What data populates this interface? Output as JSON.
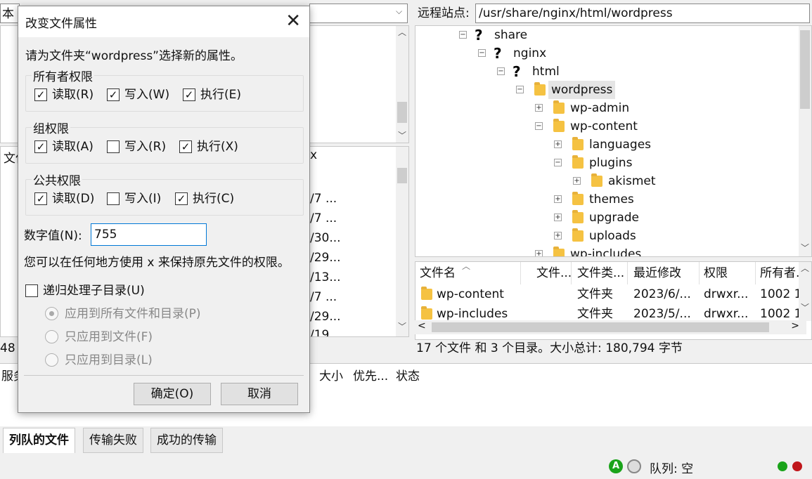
{
  "local": {
    "tab_label_partial": "本地",
    "col_name_partial": "文件",
    "col_partial_x": "x",
    "dates": [
      "/7 ...",
      "/7 ...",
      "/30...",
      "/29...",
      "/13...",
      "/7 ...",
      "/29...",
      "/19"
    ],
    "status_partial": "48"
  },
  "remote": {
    "label": "远程站点:",
    "path": "/usr/share/nginx/html/wordpress",
    "tree": [
      {
        "name": "share",
        "icon": "question-icon",
        "expander": "⊟"
      },
      {
        "name": "nginx",
        "icon": "question-icon",
        "expander": "⊟"
      },
      {
        "name": "html",
        "icon": "question-icon",
        "expander": "⊟"
      },
      {
        "name": "wordpress",
        "icon": "folder-icon",
        "expander": "⊟"
      },
      {
        "name": "wp-admin",
        "icon": "folder-icon",
        "expander": "⊞"
      },
      {
        "name": "wp-content",
        "icon": "folder-icon",
        "expander": "⊟"
      },
      {
        "name": "languages",
        "icon": "folder-icon",
        "expander": "⊞"
      },
      {
        "name": "plugins",
        "icon": "folder-icon",
        "expander": "⊟"
      },
      {
        "name": "akismet",
        "icon": "folder-icon",
        "expander": "⊞"
      },
      {
        "name": "themes",
        "icon": "folder-icon",
        "expander": "⊞"
      },
      {
        "name": "upgrade",
        "icon": "folder-icon",
        "expander": "⊞"
      },
      {
        "name": "uploads",
        "icon": "folder-icon",
        "expander": "⊞"
      },
      {
        "name": "wp-includes",
        "icon": "folder-icon",
        "expander": "⊞"
      }
    ],
    "columns": [
      "文件名",
      "文件...",
      "文件类...",
      "最近修改",
      "权限",
      "所有者..."
    ],
    "files": [
      {
        "name": "wp-content",
        "size": "",
        "type": "文件夹",
        "modified": "2023/6/...",
        "perms": "drwxr...",
        "owner": "1002 1..."
      },
      {
        "name": "wp-includes",
        "size": "",
        "type": "文件夹",
        "modified": "2023/5/...",
        "perms": "drwxr...",
        "owner": "1002 1..."
      }
    ],
    "status": "17 个文件 和 3 个目录。大小总计: 180,794 字节"
  },
  "queue": {
    "headers": [
      "服务",
      "大小",
      "优先...",
      "状态"
    ],
    "tabs": [
      "列队的文件",
      "传输失败",
      "成功的传输"
    ],
    "status": "队列: 空"
  },
  "dialog": {
    "title": "改变文件属性",
    "prompt": "请为文件夹“wordpress”选择新的属性。",
    "owner": {
      "title": "所有者权限",
      "read": "读取(R)",
      "write": "写入(W)",
      "exec": "执行(E)"
    },
    "group": {
      "title": "组权限",
      "read": "读取(A)",
      "write": "写入(R)",
      "exec": "执行(X)"
    },
    "public": {
      "title": "公共权限",
      "read": "读取(D)",
      "write": "写入(I)",
      "exec": "执行(C)"
    },
    "numeric_label": "数字值(N):",
    "numeric_value": "755",
    "hint": "您可以在任何地方使用 x 来保持原先文件的权限。",
    "recursive": "递归处理子目录(U)",
    "radio_all": "应用到所有文件和目录(P)",
    "radio_files": "只应用到文件(F)",
    "radio_dirs": "只应用到目录(L)",
    "ok": "确定(O)",
    "cancel": "取消"
  },
  "colors": {
    "folder": "#f5c242",
    "led_green": "#1aa31a",
    "led_red": "#c0161b"
  }
}
